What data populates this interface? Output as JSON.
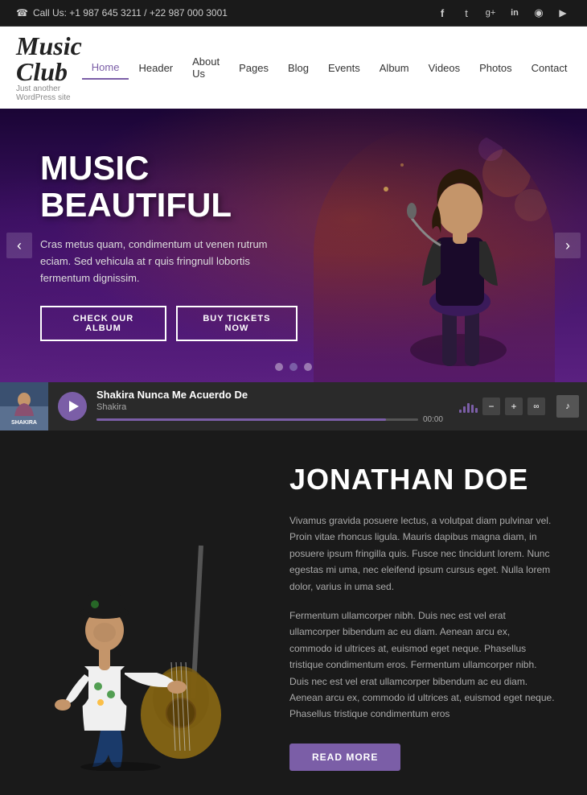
{
  "topbar": {
    "phone": "Call Us: +1 987 645 3211 / +22 987 000 3001",
    "phone_icon": "☎",
    "social": [
      {
        "name": "facebook",
        "icon": "f",
        "label": "Facebook"
      },
      {
        "name": "twitter",
        "icon": "t",
        "label": "Twitter"
      },
      {
        "name": "google-plus",
        "icon": "g+",
        "label": "Google Plus"
      },
      {
        "name": "linkedin",
        "icon": "in",
        "label": "LinkedIn"
      },
      {
        "name": "rss",
        "icon": "⚬",
        "label": "RSS"
      },
      {
        "name": "youtube",
        "icon": "▶",
        "label": "YouTube"
      }
    ]
  },
  "header": {
    "logo": "Music Club",
    "logo_sub": "Just another WordPress site",
    "nav": [
      {
        "label": "Home",
        "active": true
      },
      {
        "label": "Header",
        "active": false
      },
      {
        "label": "About Us",
        "active": false
      },
      {
        "label": "Pages",
        "active": false
      },
      {
        "label": "Blog",
        "active": false
      },
      {
        "label": "Events",
        "active": false
      },
      {
        "label": "Album",
        "active": false
      },
      {
        "label": "Videos",
        "active": false
      },
      {
        "label": "Photos",
        "active": false
      },
      {
        "label": "Contact",
        "active": false
      }
    ]
  },
  "hero": {
    "title": "MUSIC BEAUTIFUL",
    "text": "Cras metus quam, condimentum ut venen rutrum eciam. Sed vehicula at r quis fringnull lobortis fermentum dignissim.",
    "btn1": "CHECK OUR ALBUM",
    "btn2": "BUY TICKETS NOW",
    "dots": 3,
    "active_dot": 1,
    "prev_icon": "‹",
    "next_icon": "›"
  },
  "player": {
    "song_title": "Shakira Nunca Me Acuerdo De",
    "artist": "Shakira",
    "time": "00:00",
    "progress_percent": 90
  },
  "artist": {
    "name": "JONATHAN DOE",
    "desc1": "Vivamus gravida posuere lectus, a volutpat diam pulvinar vel. Proin vitae rhoncus ligula. Mauris dapibus magna diam, in posuere ipsum fringilla quis. Fusce nec tincidunt lorem. Nunc egestas mi uma, nec eleifend ipsum cursus eget. Nulla lorem dolor, varius in uma sed.",
    "desc2": "Fermentum ullamcorper nibh. Duis nec est vel erat ullamcorper bibendum ac eu diam. Aenean arcu ex, commodo id ultrices at, euismod eget neque. Phasellus tristique condimentum eros. Fermentum ullamcorper nibh. Duis nec est vel erat ullamcorper bibendum ac eu diam. Aenean arcu ex, commodo id ultrices at, euismod eget neque. Phasellus tristique condimentum eros",
    "read_more": "READ MORE"
  },
  "colors": {
    "accent": "#7b5ea7",
    "bg_dark": "#1a1a1a",
    "bg_player": "#2a2a2a",
    "text_light": "#ffffff",
    "text_muted": "#aaaaaa"
  }
}
